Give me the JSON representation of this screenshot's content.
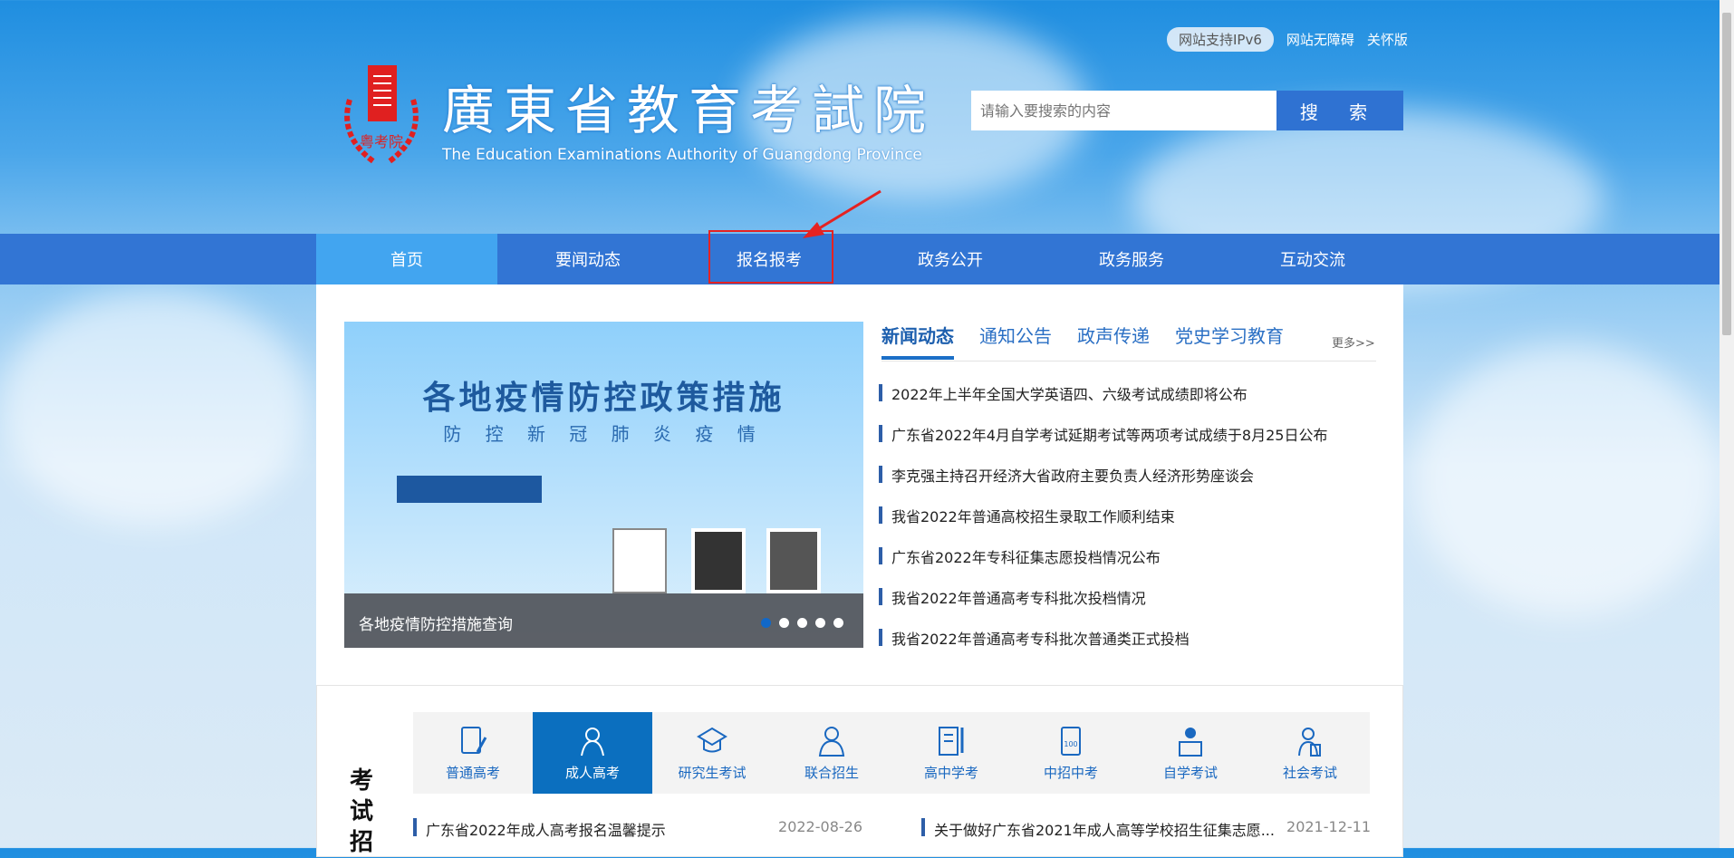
{
  "top_links": {
    "ipv6": "网站支持IPv6",
    "accessible": "网站无障碍",
    "care": "关怀版"
  },
  "logo": {
    "cn": "廣東省教育考試院",
    "en": "The Education Examinations Authority of Guangdong Province",
    "seal": "粤考院"
  },
  "search": {
    "placeholder": "请输入要搜索的内容",
    "button": "搜 索"
  },
  "nav": [
    "首页",
    "要闻动态",
    "报名报考",
    "政务公开",
    "政务服务",
    "互动交流"
  ],
  "banner": {
    "caption": "各地疫情防控措施查询",
    "title": "各地疫情防控政策措施",
    "subtitle": "防 控 新 冠 肺 炎 疫 情",
    "slides": 5,
    "active_slide": 1
  },
  "news": {
    "tabs": [
      "新闻动态",
      "通知公告",
      "政声传递",
      "党史学习教育"
    ],
    "more": "更多>>",
    "items": [
      "2022年上半年全国大学英语四、六级考试成绩即将公布",
      "广东省2022年4月自学考试延期考试等两项考试成绩于8月25日公布",
      "李克强主持召开经济大省政府主要负责人经济形势座谈会",
      "我省2022年普通高校招生录取工作顺利结束",
      "广东省2022年专科征集志愿投档情况公布",
      "我省2022年普通高考专科批次投档情况",
      "我省2022年普通高考专科批次普通类正式投档"
    ]
  },
  "exam": {
    "title": "考试招",
    "tabs": [
      "普通高考",
      "成人高考",
      "研究生考试",
      "联合招生",
      "高中学考",
      "中招中考",
      "自学考试",
      "社会考试"
    ],
    "rows": [
      {
        "title": "广东省2022年成人高考报名温馨提示",
        "date": "2022-08-26"
      },
      {
        "title": "关于做好广东省2021年成人高等学校招生征集志愿...",
        "date": "2021-12-11"
      }
    ]
  }
}
